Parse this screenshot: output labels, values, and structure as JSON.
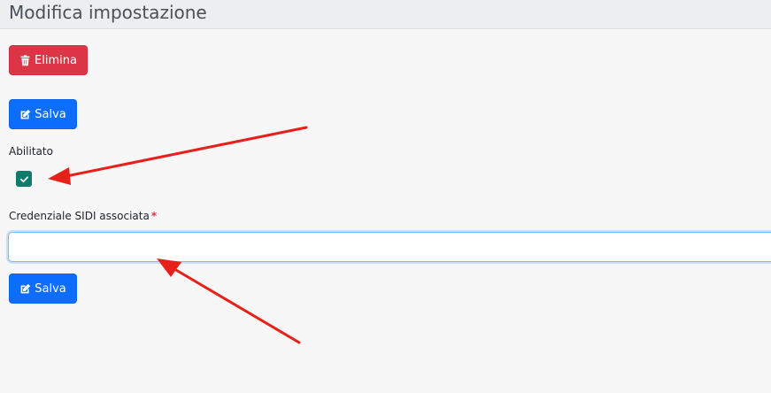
{
  "header": {
    "title": "Modifica impostazione"
  },
  "actions": {
    "delete_label": "Elimina",
    "save_label_top": "Salva",
    "save_label_bottom": "Salva"
  },
  "form": {
    "enabled_label": "Abilitato",
    "enabled_checked": true,
    "credential_label": "Credenziale SIDI associata",
    "credential_required_mark": "*",
    "credential_value": "",
    "credential_placeholder": ""
  },
  "colors": {
    "danger": "#dc3545",
    "primary": "#0d6efd",
    "checkbox": "#0f7b6c",
    "annotation_arrow": "#e8201a"
  },
  "icons": {
    "delete": "trash-icon",
    "save": "edit-square-icon",
    "check": "check-icon"
  }
}
